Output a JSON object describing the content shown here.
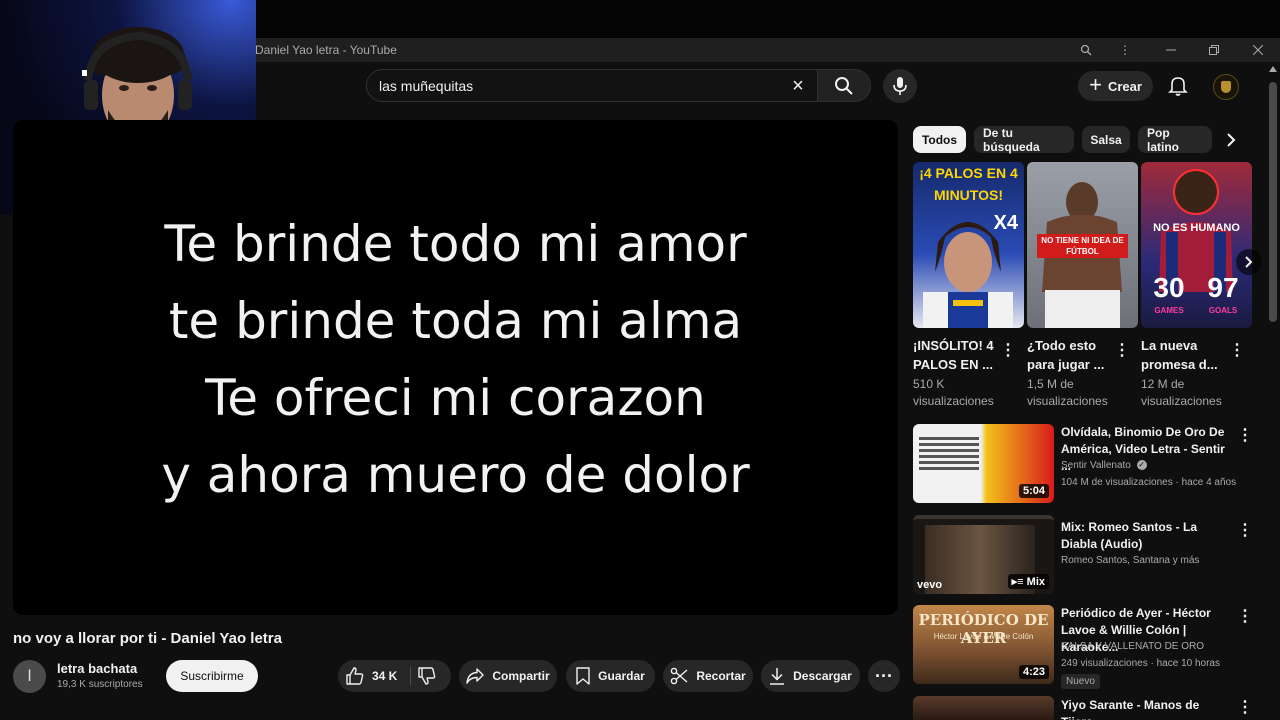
{
  "window": {
    "title": "Daniel Yao letra - YouTube"
  },
  "header": {
    "search_query": "las muñequitas",
    "create_label": "Crear"
  },
  "player": {
    "lyrics": [
      "Te brinde todo mi amor",
      "te brinde toda mi alma",
      "Te ofreci mi corazon",
      "y ahora muero de dolor"
    ]
  },
  "video": {
    "title": "no voy a llorar por ti - Daniel Yao letra",
    "channel_initial": "l",
    "channel_name": "letra bachata",
    "subscribers": "19,3 K suscriptores",
    "subscribe_label": "Suscribirme",
    "likes": "34 K",
    "share_label": "Compartir",
    "save_label": "Guardar",
    "clip_label": "Recortar",
    "download_label": "Descargar"
  },
  "chips": [
    "Todos",
    "De tu búsqueda",
    "Salsa",
    "Pop latino"
  ],
  "shorts": [
    {
      "title": "¡INSÓLITO! 4 PALOS EN ...",
      "views": "510 K visualizaciones",
      "overlay_top": "¡4 PALOS EN 4 MINUTOS!",
      "overlay_badge": "X4"
    },
    {
      "title": "¿Todo esto para jugar ...",
      "views": "1,5 M de visualizaciones",
      "overlay_top": "NO TIENE NI IDEA DE FÚTBOL",
      "overlay_badge": ""
    },
    {
      "title": "La nueva promesa d...",
      "views": "12 M de visualizaciones",
      "overlay_top": "NO ES HUMANO",
      "overlay_stat1": "30",
      "overlay_stat1_label": "GAMES",
      "overlay_stat2": "97",
      "overlay_stat2_label": "GOALS"
    }
  ],
  "related": [
    {
      "title": "Olvídala, Binomio De Oro De América, Video Letra - Sentir ...",
      "channel": "Sentir Vallenato",
      "meta": "104 M de visualizaciones · hace 4 años",
      "duration": "5:04",
      "badge": "",
      "verified": true
    },
    {
      "title": "Mix: Romeo Santos - La Diabla (Audio)",
      "channel": "Romeo Santos, Santana y más",
      "meta": "",
      "duration": "Mix",
      "badge": "",
      "verified": false,
      "thumb_logo": "vevo"
    },
    {
      "title": "Periódico de Ayer - Héctor Lavoe & Willie Colón | Karaoke...",
      "channel": "SALSA Y VALLENATO DE ORO",
      "meta": "249 visualizaciones · hace 10 horas",
      "duration": "4:23",
      "badge": "Nuevo",
      "verified": false,
      "thumb_text": "PERIÓDICO DE AYER",
      "thumb_sub": "Héctor Lavoe & Willie Colón"
    },
    {
      "title": "Yiyo Sarante - Manos de Tijera",
      "channel": "",
      "meta": "",
      "duration": "",
      "badge": "",
      "verified": false
    }
  ],
  "colors": {
    "background": "#0f0f0f",
    "surface": "#272727",
    "text": "#f1f1f1",
    "muted": "#aaaaaa",
    "brand_red": "#ff0000"
  }
}
